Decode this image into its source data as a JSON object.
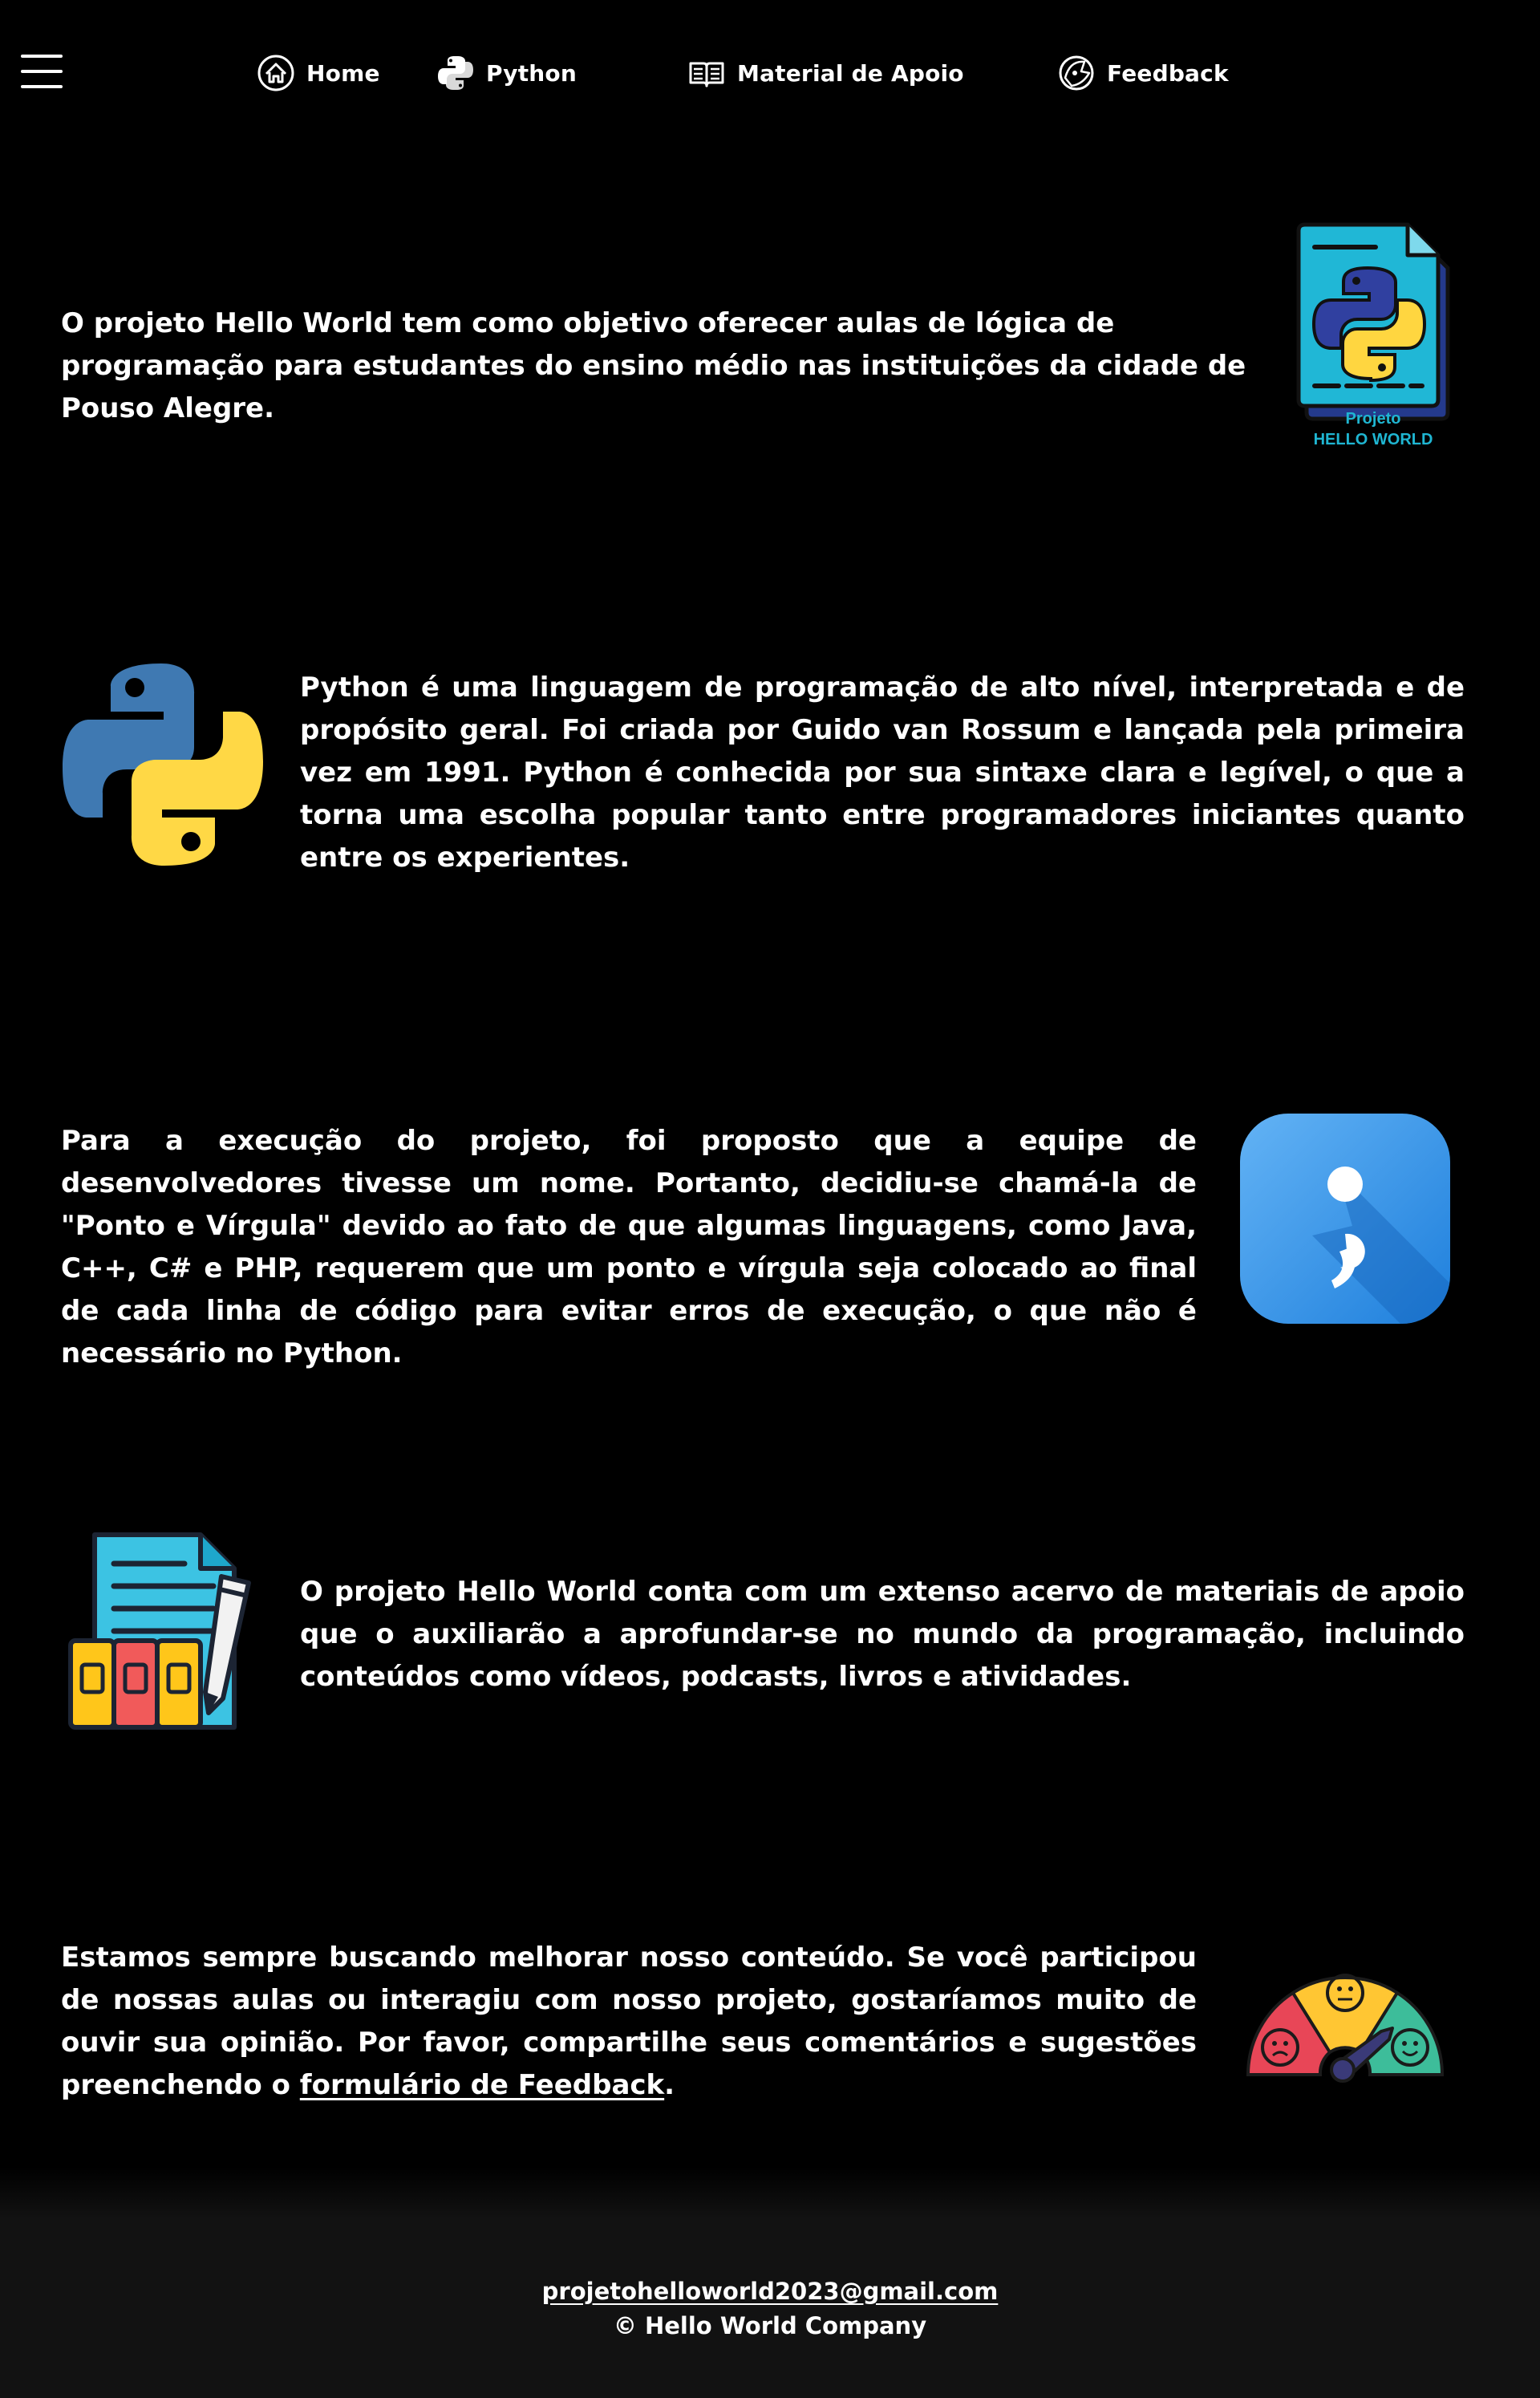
{
  "nav": {
    "menu_icon": "hamburger-menu-icon",
    "items": [
      {
        "label": "Home",
        "icon": "home-icon"
      },
      {
        "label": "Python",
        "icon": "python-logo-icon"
      },
      {
        "label": "Material de Apoio",
        "icon": "book-icon"
      },
      {
        "label": "Feedback",
        "icon": "feedback-icon"
      }
    ]
  },
  "intro": {
    "text": "O projeto Hello World tem como objetivo oferecer aulas de lógica de programação para estudantes do ensino médio nas instituições da cidade de Pouso Alegre.",
    "logo_line1": "Projeto",
    "logo_line2": "HELLO WORLD"
  },
  "python": {
    "text": "Python é uma linguagem de programação de alto nível, interpretada e de propósito geral. Foi criada por Guido van Rossum e lançada pela primeira vez em 1991. Python é conhecida por sua sintaxe clara e legível, o que a torna uma escolha popular tanto entre programadores iniciantes quanto entre os experientes."
  },
  "team": {
    "text": "Para a execução do projeto, foi proposto que a equipe de desenvolvedores tivesse um nome. Portanto, decidiu-se chamá-la de \"Ponto e Vírgula\" devido ao fato de que algumas linguagens, como Java, C++, C# e PHP, requerem que um ponto e vírgula seja colocado ao final de cada linha de código para evitar erros de execução, o que não é necessário no Python."
  },
  "materials": {
    "text": "O projeto Hello World conta com um extenso acervo de materiais de apoio que o auxiliarão a aprofundar-se no mundo da programação, incluindo conteúdos como vídeos, podcasts, livros e atividades."
  },
  "feedback": {
    "text_before": "Estamos sempre buscando melhorar nosso conteúdo. Se você participou de nossas aulas ou interagiu com nosso projeto, gostaríamos muito de ouvir sua opinião. Por favor, compartilhe seus comentários e sugestões preenchendo o ",
    "link": "formulário de Feedback",
    "text_after": "."
  },
  "footer": {
    "email": "projetohelloworld2023@gmail.com",
    "copyright": "© Hello World Company"
  },
  "colors": {
    "background": "#000000",
    "text": "#ffffff",
    "footer_bg": "#121212",
    "python_blue": "#3a75b0",
    "python_yellow": "#ffd845",
    "semicolon_blue": "#2f8de4"
  }
}
